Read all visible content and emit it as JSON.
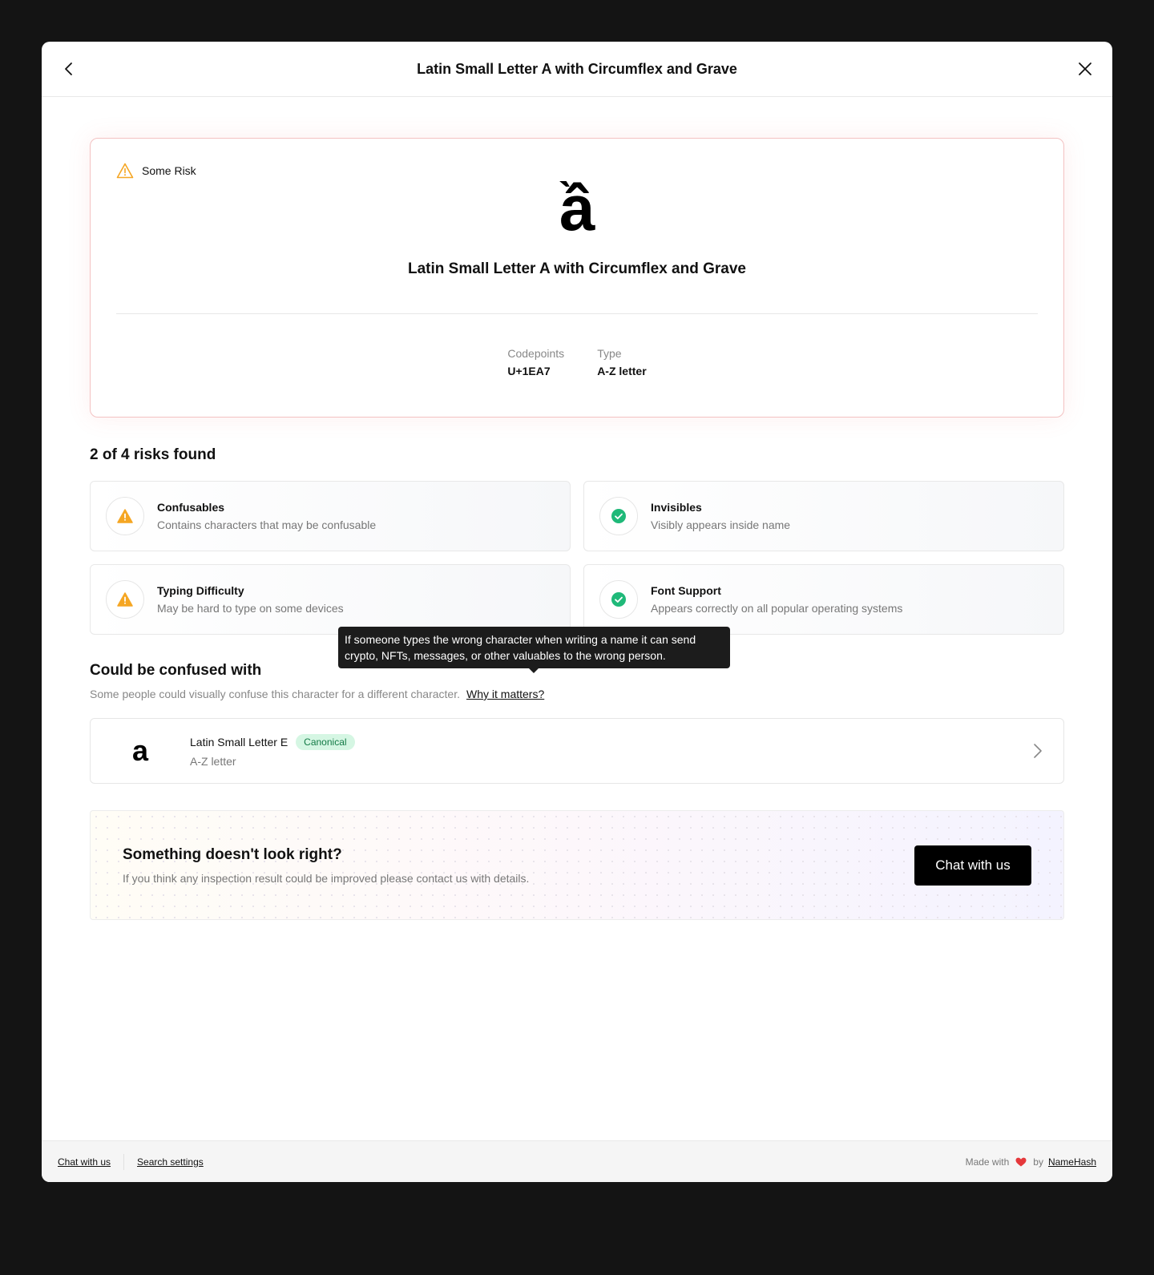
{
  "modal": {
    "title": "Latin Small Letter A with Circumflex and Grave"
  },
  "character": {
    "glyph": "ầ",
    "name": "Latin Small Letter A with Circumflex and Grave",
    "risk_label": "Some Risk",
    "codepoints_label": "Codepoints",
    "codepoints_value": "U+1EA7",
    "type_label": "Type",
    "type_value": "A-Z letter"
  },
  "risks": {
    "title": "2 of 4 risks found",
    "items": [
      {
        "name": "Confusables",
        "desc": "Contains characters that may be confusable",
        "status": "warning"
      },
      {
        "name": "Invisibles",
        "desc": "Visibly appears inside name",
        "status": "ok"
      },
      {
        "name": "Typing Difficulty",
        "desc": "May be hard to type on some devices",
        "status": "warning"
      },
      {
        "name": "Font Support",
        "desc": "Appears correctly on all popular operating systems",
        "status": "ok"
      }
    ]
  },
  "confused": {
    "title": "Could be confused with",
    "subtitle": "Some people could visually confuse this character for a different character.",
    "why_link": "Why it matters?",
    "tooltip": "If someone types the wrong character when writing a name it can send crypto, NFTs, messages, or other valuables to the wrong person.",
    "items": [
      {
        "glyph": "a",
        "name": "Latin Small Letter E",
        "badge": "Canonical",
        "type": "A-Z letter"
      }
    ]
  },
  "feedback": {
    "title": "Something doesn't look right?",
    "subtitle": "If you think any inspection result could be improved please contact us with details.",
    "button": "Chat with us"
  },
  "footer": {
    "chat_link": "Chat with us",
    "settings_link": "Search settings",
    "made_with": "Made with",
    "by": "by",
    "brand": "NameHash"
  },
  "colors": {
    "warning": "#f5a623",
    "ok": "#1fb979",
    "heart": "#e5383b",
    "risk_border": "#f3c2c2"
  }
}
